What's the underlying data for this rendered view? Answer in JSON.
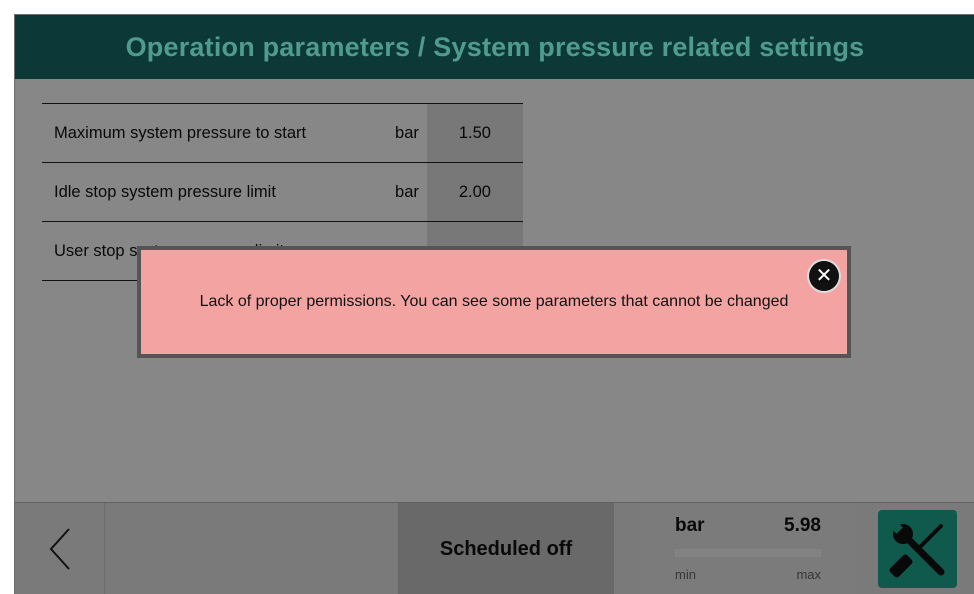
{
  "header": {
    "title": "Operation parameters / System pressure related settings"
  },
  "params": [
    {
      "label": "Maximum system pressure to start",
      "unit": "bar",
      "value": "1.50"
    },
    {
      "label": "Idle stop system pressure limit",
      "unit": "bar",
      "value": "2.00"
    },
    {
      "label": "User stop system pressure limit",
      "unit": "",
      "value": ""
    }
  ],
  "alert": {
    "message": "Lack of proper permissions. You can see some parameters that cannot be changed",
    "close_icon": "close-icon"
  },
  "footer": {
    "back_icon": "chevron-left-icon",
    "status": "Scheduled off",
    "gauge": {
      "unit": "bar",
      "value": "5.98",
      "min_label": "min",
      "max_label": "max",
      "level": 0.0
    },
    "tools_icon": "wrench-screwdriver-icon"
  },
  "colors": {
    "header_bg": "#0d3838",
    "header_text": "#4f9b8d",
    "alert_bg": "#f4a3a3",
    "tools_bg": "#1fa991"
  }
}
